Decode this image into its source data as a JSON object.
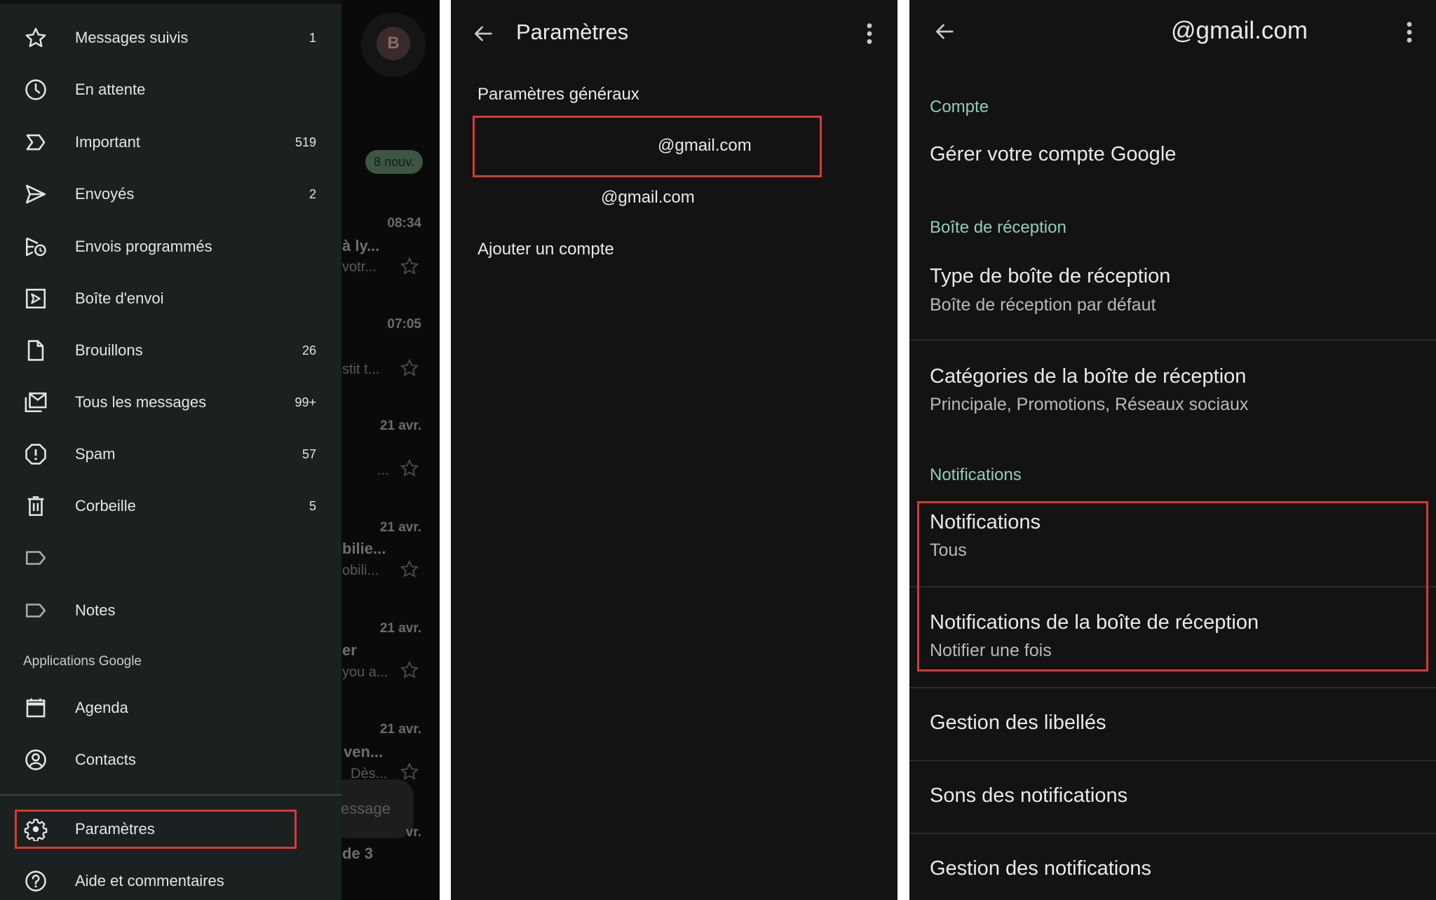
{
  "drawer": {
    "items": [
      {
        "label": "Messages suivis",
        "count": "1",
        "icon": "star-icon"
      },
      {
        "label": "En attente",
        "count": "",
        "icon": "clock-icon"
      },
      {
        "label": "Important",
        "count": "519",
        "icon": "important-icon"
      },
      {
        "label": "Envoyés",
        "count": "2",
        "icon": "send-icon"
      },
      {
        "label": "Envois programmés",
        "count": "",
        "icon": "scheduled-send-icon"
      },
      {
        "label": "Boîte d'envoi",
        "count": "",
        "icon": "outbox-icon"
      },
      {
        "label": "Brouillons",
        "count": "26",
        "icon": "draft-icon"
      },
      {
        "label": "Tous les messages",
        "count": "99+",
        "icon": "all-mail-icon"
      },
      {
        "label": "Spam",
        "count": "57",
        "icon": "spam-icon"
      },
      {
        "label": "Corbeille",
        "count": "5",
        "icon": "trash-icon"
      },
      {
        "label": "",
        "count": "",
        "icon": "label-icon"
      },
      {
        "label": "Notes",
        "count": "",
        "icon": "label-icon"
      }
    ],
    "apps_section": "Applications Google",
    "apps": [
      {
        "label": "Agenda",
        "icon": "calendar-icon"
      },
      {
        "label": "Contacts",
        "icon": "contacts-icon"
      }
    ],
    "settings": {
      "label": "Paramètres",
      "icon": "gear-icon"
    },
    "help": {
      "label": "Aide et commentaires",
      "icon": "help-icon"
    }
  },
  "backdrop": {
    "avatar_letter": "B",
    "new_pill": "8 nouv.",
    "rows": [
      {
        "time": "08:34",
        "line1": "à ly...",
        "line2": "votr..."
      },
      {
        "time": "07:05",
        "line1": "",
        "line2": "stit t..."
      },
      {
        "time": "21 avr.",
        "line1": "",
        "line2": "..."
      },
      {
        "time": "21 avr.",
        "line1": "bilie...",
        "line2": "obili..."
      },
      {
        "time": "21 avr.",
        "line1": "er",
        "line2": "you a..."
      },
      {
        "time": "21 avr.",
        "line1": "ven...",
        "line2": "Dès..."
      },
      {
        "time": "vr.",
        "line1": "de 3",
        "line2": ""
      }
    ],
    "compose_fab": "essage"
  },
  "settings_list": {
    "title": "Paramètres",
    "general": "Paramètres généraux",
    "accounts": [
      "@gmail.com",
      "@gmail.com"
    ],
    "add_account": "Ajouter un compte"
  },
  "account_settings": {
    "title": "@gmail.com",
    "sections": {
      "account": "Compte",
      "inbox": "Boîte de réception",
      "notifications": "Notifications"
    },
    "manage_account": "Gérer votre compte Google",
    "inbox_type": {
      "title": "Type de boîte de réception",
      "value": "Boîte de réception par défaut"
    },
    "inbox_categories": {
      "title": "Catégories de la boîte de réception",
      "value": "Principale, Promotions, Réseaux sociaux"
    },
    "notifications": {
      "title": "Notifications",
      "value": "Tous"
    },
    "inbox_notifications": {
      "title": "Notifications de la boîte de réception",
      "value": "Notifier une fois"
    },
    "label_management": "Gestion des libellés",
    "notification_sounds": "Sons des notifications",
    "notification_management": "Gestion des notifications"
  },
  "colors": {
    "highlight": "#d63a35",
    "section_accent": "#8fd1b4",
    "drawer_bg": "#1b2120",
    "panel_bg": "#131313"
  }
}
